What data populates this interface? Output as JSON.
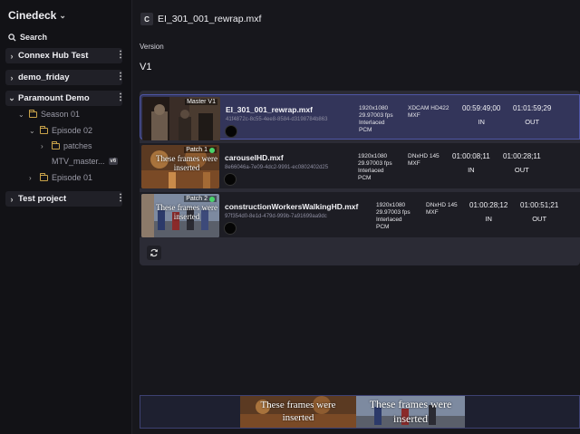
{
  "app": {
    "name": "Cinedeck"
  },
  "sidebar": {
    "search_label": "Search",
    "projects": [
      {
        "label": "Connex Hub Test"
      },
      {
        "label": "demo_friday"
      },
      {
        "label": "Paramount Demo"
      },
      {
        "label": "Test project"
      }
    ],
    "tree": {
      "season": "Season 01",
      "episode2": "Episode 02",
      "patches": "patches",
      "master": "MTV_master...",
      "master_badge": "v6",
      "episode1": "Episode 01"
    }
  },
  "header": {
    "badge": "C",
    "title": "EI_301_001_rewrap.mxf"
  },
  "version": {
    "label": "Version",
    "value": "V1"
  },
  "clips": [
    {
      "tag": "Master V1",
      "filename": "EI_301_001_rewrap.mxf",
      "uuid": "41f4872c-8c55-4ee8-8584-d3198784b863",
      "spec": [
        "1920x1080",
        "29.97003 fps",
        "Interlaced",
        "PCM"
      ],
      "codec": [
        "XDCAM HD422",
        "MXF"
      ],
      "in_tc": "00:59:49;00",
      "in_label": "IN",
      "out_tc": "01:01:59;29",
      "out_label": "OUT"
    },
    {
      "tag": "Patch 1",
      "overlay": "These frames were inserted",
      "filename": "carouselHD.mxf",
      "uuid": "8e66046a-7e09-4dc2-9991-ec0802402d25",
      "spec": [
        "1920x1080",
        "29.97003 fps",
        "Interlaced",
        "PCM"
      ],
      "codec": [
        "DNxHD 145",
        "MXF"
      ],
      "in_tc": "01:00:08;11",
      "in_label": "IN",
      "out_tc": "01:00:28;11",
      "out_label": "OUT"
    },
    {
      "tag": "Patch 2",
      "overlay": "These frames were inserted",
      "filename": "constructionWorkersWalkingHD.mxf",
      "uuid": "97f354d0-8e1d-479d-999b-7a91699aa9dc",
      "spec": [
        "1920x1080",
        "29.97003 fps",
        "Interlaced",
        "PCM"
      ],
      "codec": [
        "DNxHD 145",
        "MXF"
      ],
      "in_tc": "01:00:28;12",
      "in_label": "IN",
      "out_tc": "01:00:51;21",
      "out_label": "OUT"
    }
  ],
  "timeline": {
    "clip1_text": "These frames were inserted",
    "clip2_text": "These frames were inserted"
  },
  "icons": {
    "chevron_down": "chevron-down-icon",
    "search": "search-icon",
    "chevron_right": "chevron-right-icon",
    "folder": "folder-icon",
    "kebab": "kebab-menu-icon",
    "refresh": "refresh-icon"
  },
  "colors": {
    "background": "#17171c",
    "sidebar": "#121216",
    "selected_row": "#33355a",
    "selected_border": "#4f56a6",
    "folder": "#c9a34a",
    "status_dot": "#49d46a"
  }
}
